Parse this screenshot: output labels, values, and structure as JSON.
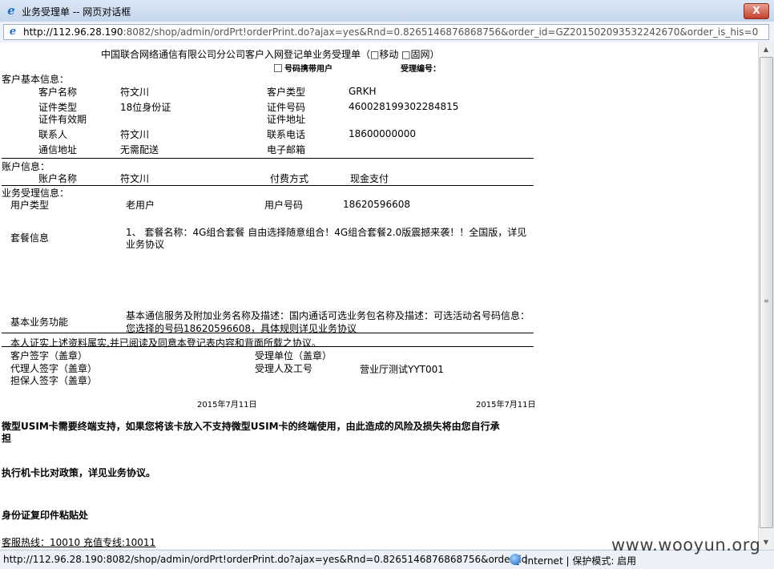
{
  "window": {
    "title": "业务受理单 -- 网页对话框",
    "close_label": "X",
    "address_prefix": "http://112.96.28.190",
    "address_rest": ":8082/shop/admin/ordPrt!orderPrint.do?ajax=yes&Rnd=0.8265146876868756&order_id=GZ2015020935322426​70&order_is_his=0"
  },
  "doc": {
    "header": "中国联合网络通信有限公司分公司客户入网登记单业务受理单（□移动 □固网）",
    "portable_label": "号码携带用户",
    "accept_no_label": "受理编号：",
    "customer_section": "客户基本信息：",
    "customer": {
      "name_label": "客户名称",
      "name_value": "符文川",
      "type_label": "客户类型",
      "type_value": "GRKH",
      "idtype_label": "证件类型",
      "idtype_value": "18位身份证",
      "idno_label": "证件号码",
      "idno_value": "460028199302284815",
      "idvalid_label": "证件有效期",
      "idaddr_label": "证件地址",
      "contact_label": "联系人",
      "contact_value": "符文川",
      "phone_label": "联系电话",
      "phone_value": "18600000000",
      "addr_label": "通信地址",
      "addr_value": "无需配送",
      "email_label": "电子邮箱"
    },
    "account_section": "账户信息：",
    "account": {
      "name_label": "账户名称",
      "name_value": "符文川",
      "pay_label": "付费方式",
      "pay_value": "现金支付"
    },
    "business_section": "业务受理信息：",
    "business": {
      "usertype_label": "用户类型",
      "usertype_value": "老用户",
      "usernum_label": "用户号码",
      "usernum_value": "18620596608",
      "package_label": "套餐信息",
      "package_line1": "1、 套餐名称：4G组合套餐 自由选择随意组合！4G组合套餐2.0版震撼来袭！！全国版，详见",
      "package_line2": "业务协议",
      "basic_label": "基本业务功能",
      "basic_line1": "基本通信服务及附加业务名称及描述：国内通话可选业务包名称及描述：可选活动名号码信息：",
      "basic_line2": "您选择的号码18620596608，具体规则详见业务协议"
    },
    "declaration": "本人证实上述资料属实,并已阅读及同意本登记表内容和背面所载之协议。",
    "sign": {
      "customer": "客户签字（盖章）",
      "agent": "代理人签字（盖章）",
      "guarantor": "担保人签字（盖章）",
      "unit": "受理单位（盖章）",
      "handler": "受理人及工号",
      "handler_value": "营业厅测试YYT001"
    },
    "date_left": "2015年7月11日",
    "date_right": "2015年7月11日",
    "note1_line1": "微型USIM卡需要终端支持，如果您将该卡放入不支持微型USIM卡的终端使用，由此造成的风险及损失将由您自行承",
    "note1_line2": "担",
    "note2": "执行机卡比对政策，详见业务协议。",
    "note3": "身份证复印件粘贴处",
    "hotline": "客服热线：10010 充值专线:10011"
  },
  "status": {
    "url": "http://112.96.28.190:8082/shop/admin/ordPrt!orderPrint.do?ajax=yes&Rnd=0.8265146876868756&order_id",
    "zone": "Internet | 保护模式: 启用"
  },
  "watermark": "www.wooyun.org"
}
